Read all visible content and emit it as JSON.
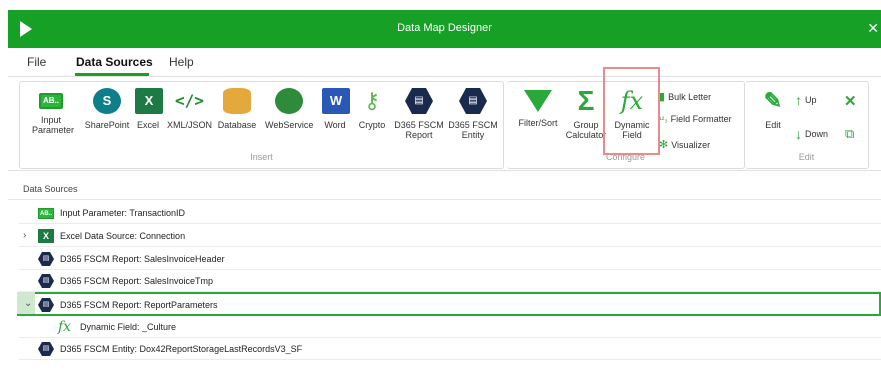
{
  "window": {
    "title": "Data Map Designer"
  },
  "menu": {
    "items": [
      "File",
      "Data Sources",
      "Help"
    ]
  },
  "ribbon": {
    "insert": {
      "label": "Insert",
      "buttons": [
        {
          "label": "Input Parameter",
          "icon": "input-parameter-icon",
          "glyph": "AB.."
        },
        {
          "label": "SharePoint",
          "icon": "sharepoint-icon",
          "glyph": "S"
        },
        {
          "label": "Excel",
          "icon": "excel-icon",
          "glyph": "X"
        },
        {
          "label": "XML/JSON",
          "icon": "xml-json-icon",
          "glyph": "</>"
        },
        {
          "label": "Database",
          "icon": "database-icon"
        },
        {
          "label": "WebService",
          "icon": "globe-icon"
        },
        {
          "label": "Word",
          "icon": "word-icon",
          "glyph": "W"
        },
        {
          "label": "Crypto",
          "icon": "key-icon",
          "glyph": "⚷"
        },
        {
          "label": "D365 FSCM Report",
          "icon": "d365-report-icon",
          "glyph": "▤"
        },
        {
          "label": "D365 FSCM Entity",
          "icon": "d365-entity-icon",
          "glyph": "▤"
        }
      ]
    },
    "configure": {
      "label": "Configure",
      "buttons": [
        {
          "label": "Filter/Sort",
          "icon": "filter-icon"
        },
        {
          "label": "Group Calculator",
          "icon": "sigma-icon",
          "glyph": "Σ"
        },
        {
          "label": "Dynamic Field",
          "icon": "fx-icon",
          "glyph": "fx"
        }
      ],
      "small_buttons": [
        {
          "label": "Bulk Letter",
          "icon": "bulk-letter-icon",
          "glyph": "▮"
        },
        {
          "label": "Field Formatter",
          "icon": "field-formatter-icon",
          "glyph": "¹²₃"
        },
        {
          "label": "Visualizer",
          "icon": "visualizer-icon",
          "glyph": "✻"
        }
      ]
    },
    "edit": {
      "label": "Edit",
      "edit_label": "Edit",
      "up_label": "Up",
      "down_label": "Down"
    }
  },
  "data_sources": {
    "header": "Data Sources",
    "rows": [
      {
        "label": "Input Parameter: TransactionID",
        "icon": "input-parameter-icon",
        "glyph": "AB.."
      },
      {
        "label": "Excel Data Source: Connection",
        "icon": "excel-icon",
        "glyph": "X",
        "expander": "›"
      },
      {
        "label": "D365 FSCM Report: SalesInvoiceHeader",
        "icon": "d365-report-icon",
        "glyph": "▤"
      },
      {
        "label": "D365 FSCM Report: SalesInvoiceTmp",
        "icon": "d365-report-icon",
        "glyph": "▤"
      },
      {
        "label": "D365 FSCM Report: ReportParameters",
        "icon": "d365-report-icon",
        "glyph": "▤",
        "expander": "⌄",
        "selected": true
      },
      {
        "label": "Dynamic Field: _Culture",
        "icon": "fx-icon",
        "glyph": "fx"
      },
      {
        "label": "D365 FSCM Entity: Dox42ReportStorageLastRecordsV3_SF",
        "icon": "d365-entity-icon",
        "glyph": "▤"
      }
    ]
  },
  "colors": {
    "brand": "#16a026",
    "highlight": "#e88b8b",
    "selection": "#2aa83a"
  }
}
